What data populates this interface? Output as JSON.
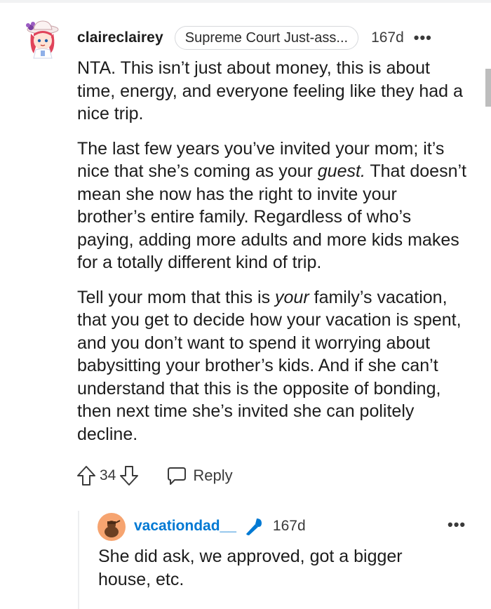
{
  "comment": {
    "username": "claireclairey",
    "flair": "Supreme Court Just-ass...",
    "age": "167d",
    "more": "•••",
    "paragraphs": [
      {
        "text": "NTA. This isn’t just about money, this is about time, energy, and everyone feeling like they had a nice trip."
      },
      {
        "pre": "The last few years you’ve invited your mom; it’s nice that she’s coming as your ",
        "em": "guest.",
        "post": " That doesn’t mean she now has the right to invite your brother’s entire family. Regardless of who’s paying, adding more adults and more kids makes for a totally different kind of trip."
      },
      {
        "pre": "Tell your mom that this is ",
        "em": "your",
        "post": " family’s vacation, that you get to decide how your vacation is spent, and you don’t want to spend it worrying about babysitting your brother’s kids. And if she can’t understand that this is the opposite of bonding, then next time she’s invited she can politely decline."
      }
    ],
    "votes": "34",
    "reply_label": "Reply",
    "icons": {
      "upvote": "upvote-arrow-icon",
      "downvote": "downvote-arrow-icon",
      "reply": "speech-bubble-icon",
      "more": "more-dots-icon"
    }
  },
  "reply": {
    "username": "vacationdad__",
    "age": "167d",
    "more": "•••",
    "text": "She did ask, we approved, got a bigger house, etc.",
    "icons": {
      "badge": "microphone-icon"
    }
  },
  "colors": {
    "text": "#1c1c1c",
    "meta": "#3a3a3a",
    "reply_username": "#0079d3",
    "flair_border": "#d7d9dc",
    "avatar_bg": "#f6a470"
  }
}
